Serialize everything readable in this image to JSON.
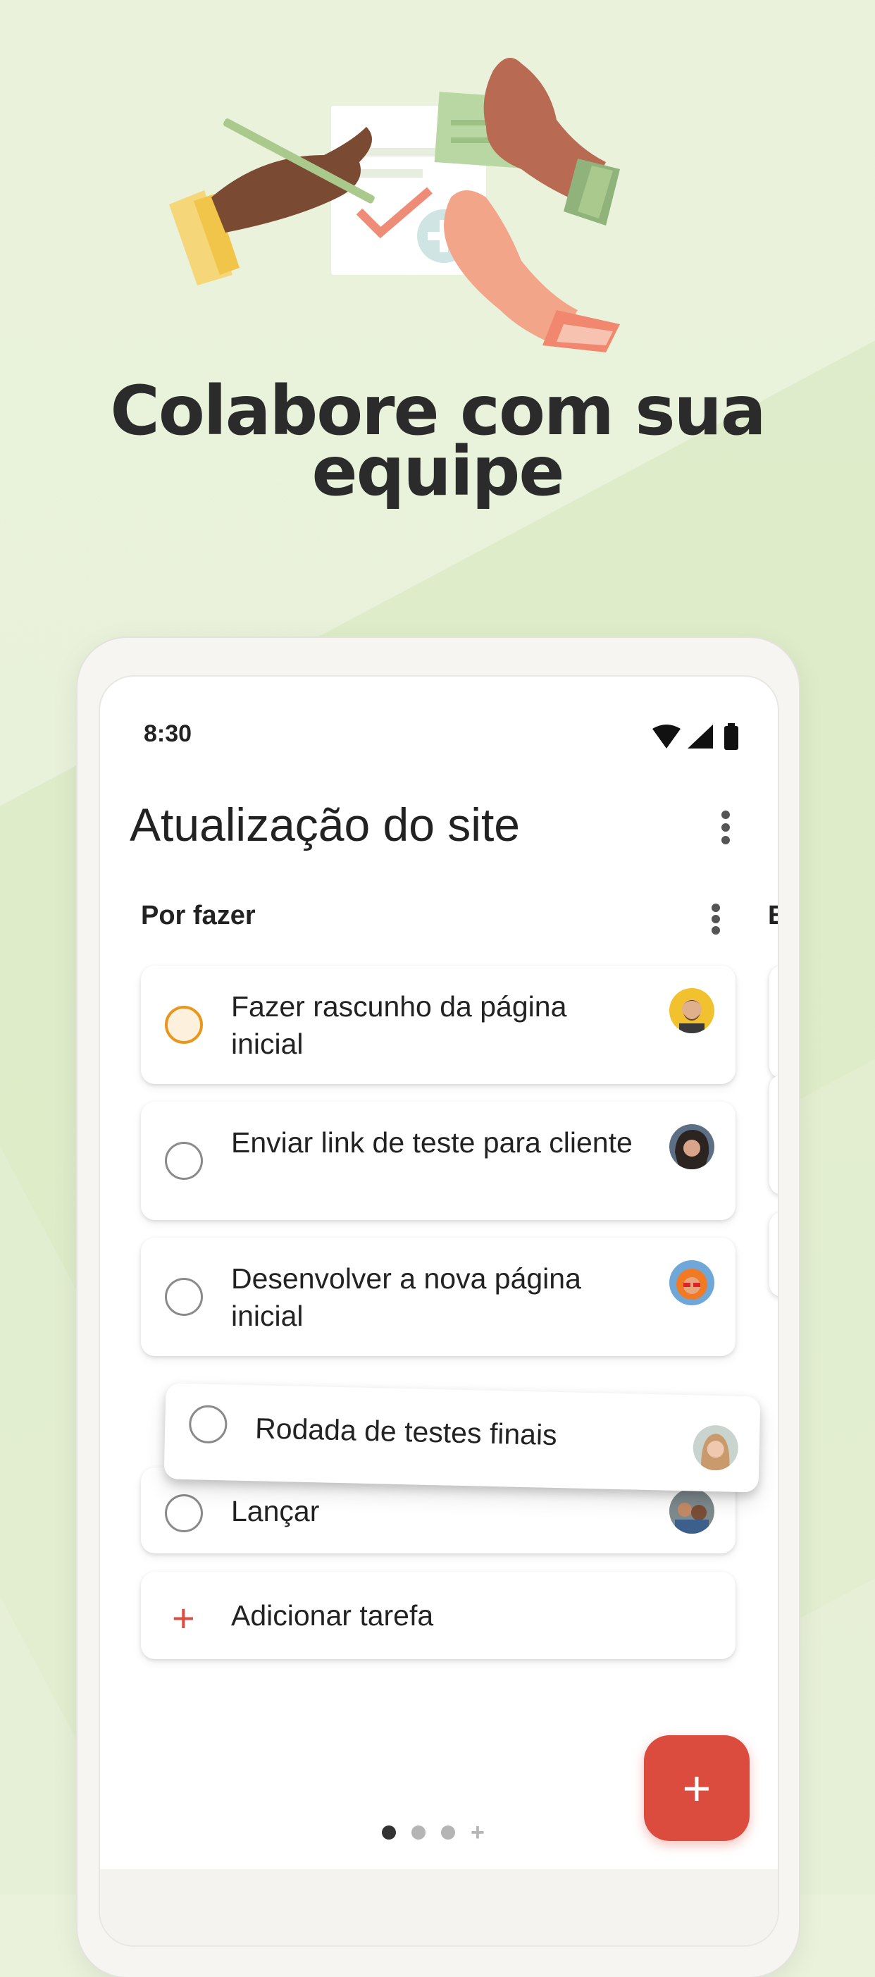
{
  "headline": {
    "line1": "Colabore com sua",
    "line2": "equipe"
  },
  "status_bar": {
    "time": "8:30",
    "icons": [
      "wifi-icon",
      "signal-icon",
      "battery-icon"
    ]
  },
  "project": {
    "title": "Atualização do site",
    "menu_icon": "kebab-menu-icon"
  },
  "section": {
    "title": "Por fazer",
    "menu_icon": "kebab-menu-icon",
    "next_section_initial": "E"
  },
  "tasks": [
    {
      "text": "Fazer rascunho da página inicial",
      "priority": true,
      "avatar": "avatar-man-beard"
    },
    {
      "text": "Enviar link de teste para cliente",
      "priority": false,
      "avatar": "avatar-woman-dark-hair"
    },
    {
      "text": "Desenvolver a nova página inicial",
      "priority": false,
      "avatar": "avatar-person-orange"
    },
    {
      "text": "Lançar",
      "priority": false,
      "avatar": "avatar-couple"
    }
  ],
  "dragged_task": {
    "text": "Rodada de testes finais",
    "avatar": "avatar-woman-blonde"
  },
  "add_task": {
    "label": "Adicionar tarefa",
    "icon": "plus-icon"
  },
  "fab": {
    "label": "+",
    "icon": "plus-icon"
  },
  "pagination": {
    "count": 3,
    "active": 0,
    "extra": "+"
  },
  "colors": {
    "accent": "#dc4c3e",
    "priority": "#e8961c",
    "background": "#e8f1da"
  }
}
